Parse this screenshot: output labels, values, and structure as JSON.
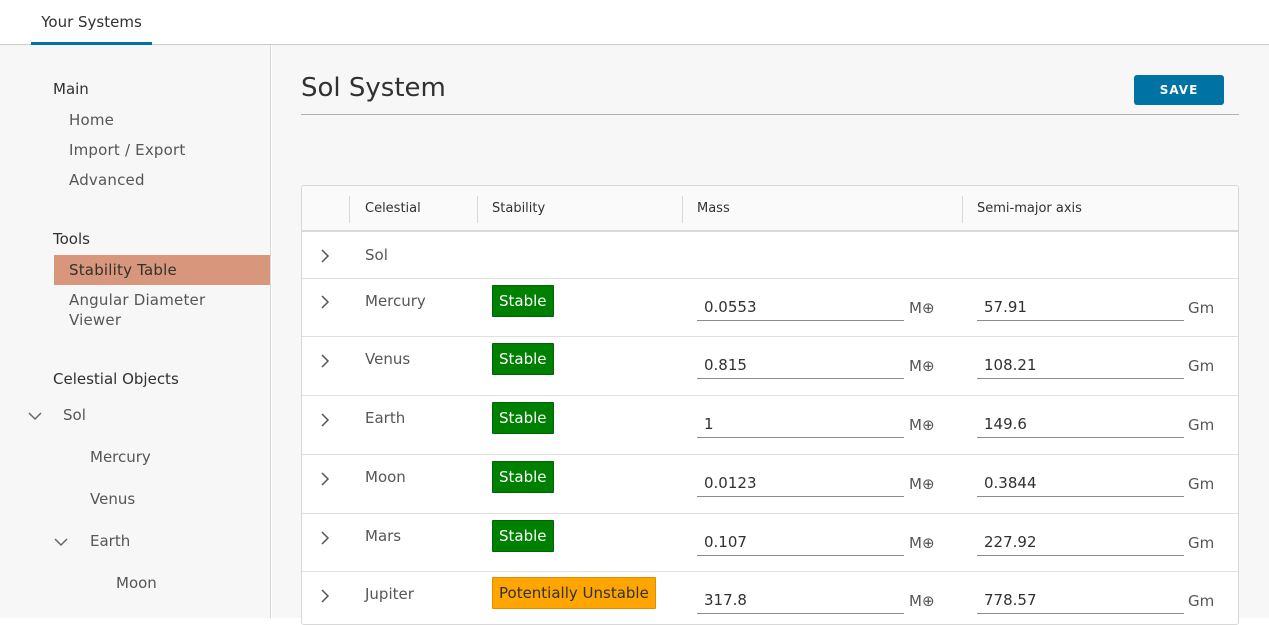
{
  "header": {
    "tab_label": "Your Systems"
  },
  "sidebar": {
    "main_heading": "Main",
    "main_links": [
      "Home",
      "Import / Export",
      "Advanced"
    ],
    "tools_heading": "Tools",
    "tools_links": [
      "Stability Table",
      "Angular Diameter Viewer"
    ],
    "active_tool": "Stability Table",
    "objects_heading": "Celestial Objects",
    "tree": {
      "sol": "Sol",
      "mercury": "Mercury",
      "venus": "Venus",
      "earth": "Earth",
      "moon": "Moon"
    }
  },
  "main": {
    "title": "Sol System",
    "save_label": "SAVE",
    "columns": [
      "Celestial",
      "Stability",
      "Mass",
      "Semi-major axis"
    ],
    "mass_unit": "M⊕",
    "axis_unit": "Gm",
    "rows": [
      {
        "name": "Sol",
        "stability": "",
        "mass": "",
        "axis": ""
      },
      {
        "name": "Mercury",
        "stability": "Stable",
        "mass": "0.0553",
        "axis": "57.91"
      },
      {
        "name": "Venus",
        "stability": "Stable",
        "mass": "0.815",
        "axis": "108.21"
      },
      {
        "name": "Earth",
        "stability": "Stable",
        "mass": "1",
        "axis": "149.6"
      },
      {
        "name": "Moon",
        "stability": "Stable",
        "mass": "0.0123",
        "axis": "0.3844"
      },
      {
        "name": "Mars",
        "stability": "Stable",
        "mass": "0.107",
        "axis": "227.92"
      },
      {
        "name": "Jupiter",
        "stability": "Potentially Unstable",
        "mass": "317.8",
        "axis": "778.57"
      }
    ]
  },
  "colors": {
    "accent": "#0072a3",
    "active_nav": "#d8967c",
    "stable": "#008000",
    "unstable": "#ffa500"
  }
}
